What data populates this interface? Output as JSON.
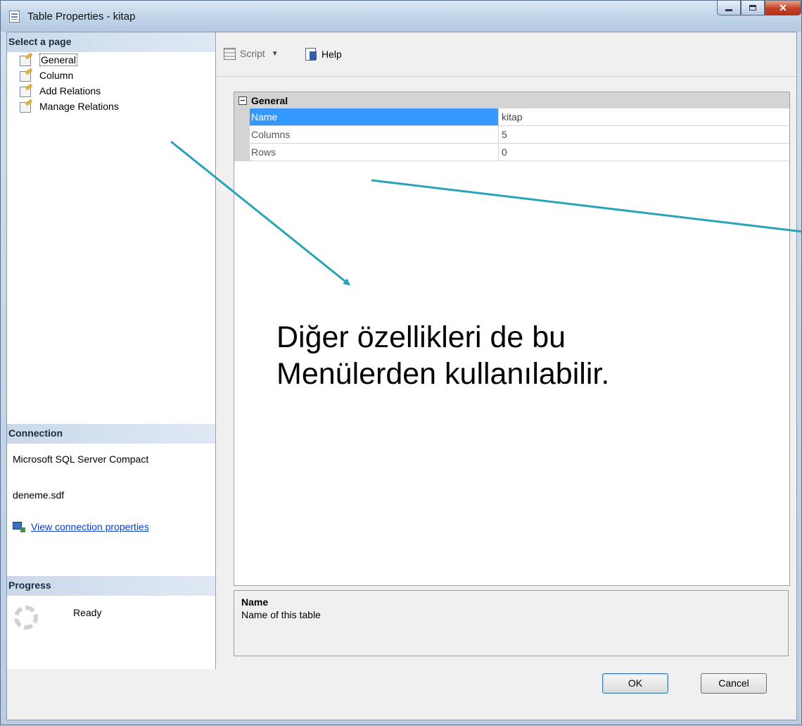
{
  "window": {
    "title": "Table Properties - kitap"
  },
  "left_pane": {
    "select_page_header": "Select a page",
    "pages": [
      {
        "label": "General"
      },
      {
        "label": "Column"
      },
      {
        "label": "Add Relations"
      },
      {
        "label": "Manage Relations"
      }
    ],
    "connection_header": "Connection",
    "connection_server": "Microsoft SQL Server Compact",
    "connection_database": "deneme.sdf",
    "view_connection_link": "View connection properties",
    "progress_header": "Progress",
    "progress_status": "Ready"
  },
  "toolbar": {
    "script_label": "Script",
    "help_label": "Help"
  },
  "property_grid": {
    "category": "General",
    "properties": [
      {
        "name": "Name",
        "value": "kitap"
      },
      {
        "name": "Columns",
        "value": "5"
      },
      {
        "name": "Rows",
        "value": "0"
      }
    ]
  },
  "description": {
    "title": "Name",
    "text": "Name of this table"
  },
  "buttons": {
    "ok": "OK",
    "cancel": "Cancel"
  },
  "annotation": {
    "line1": "Diğer özellikleri de bu",
    "line2": "Menülerden kullanılabilir."
  },
  "colors": {
    "arrow": "#2aa3b8",
    "selection": "#3399ff",
    "section_header": "#cad9ea"
  }
}
